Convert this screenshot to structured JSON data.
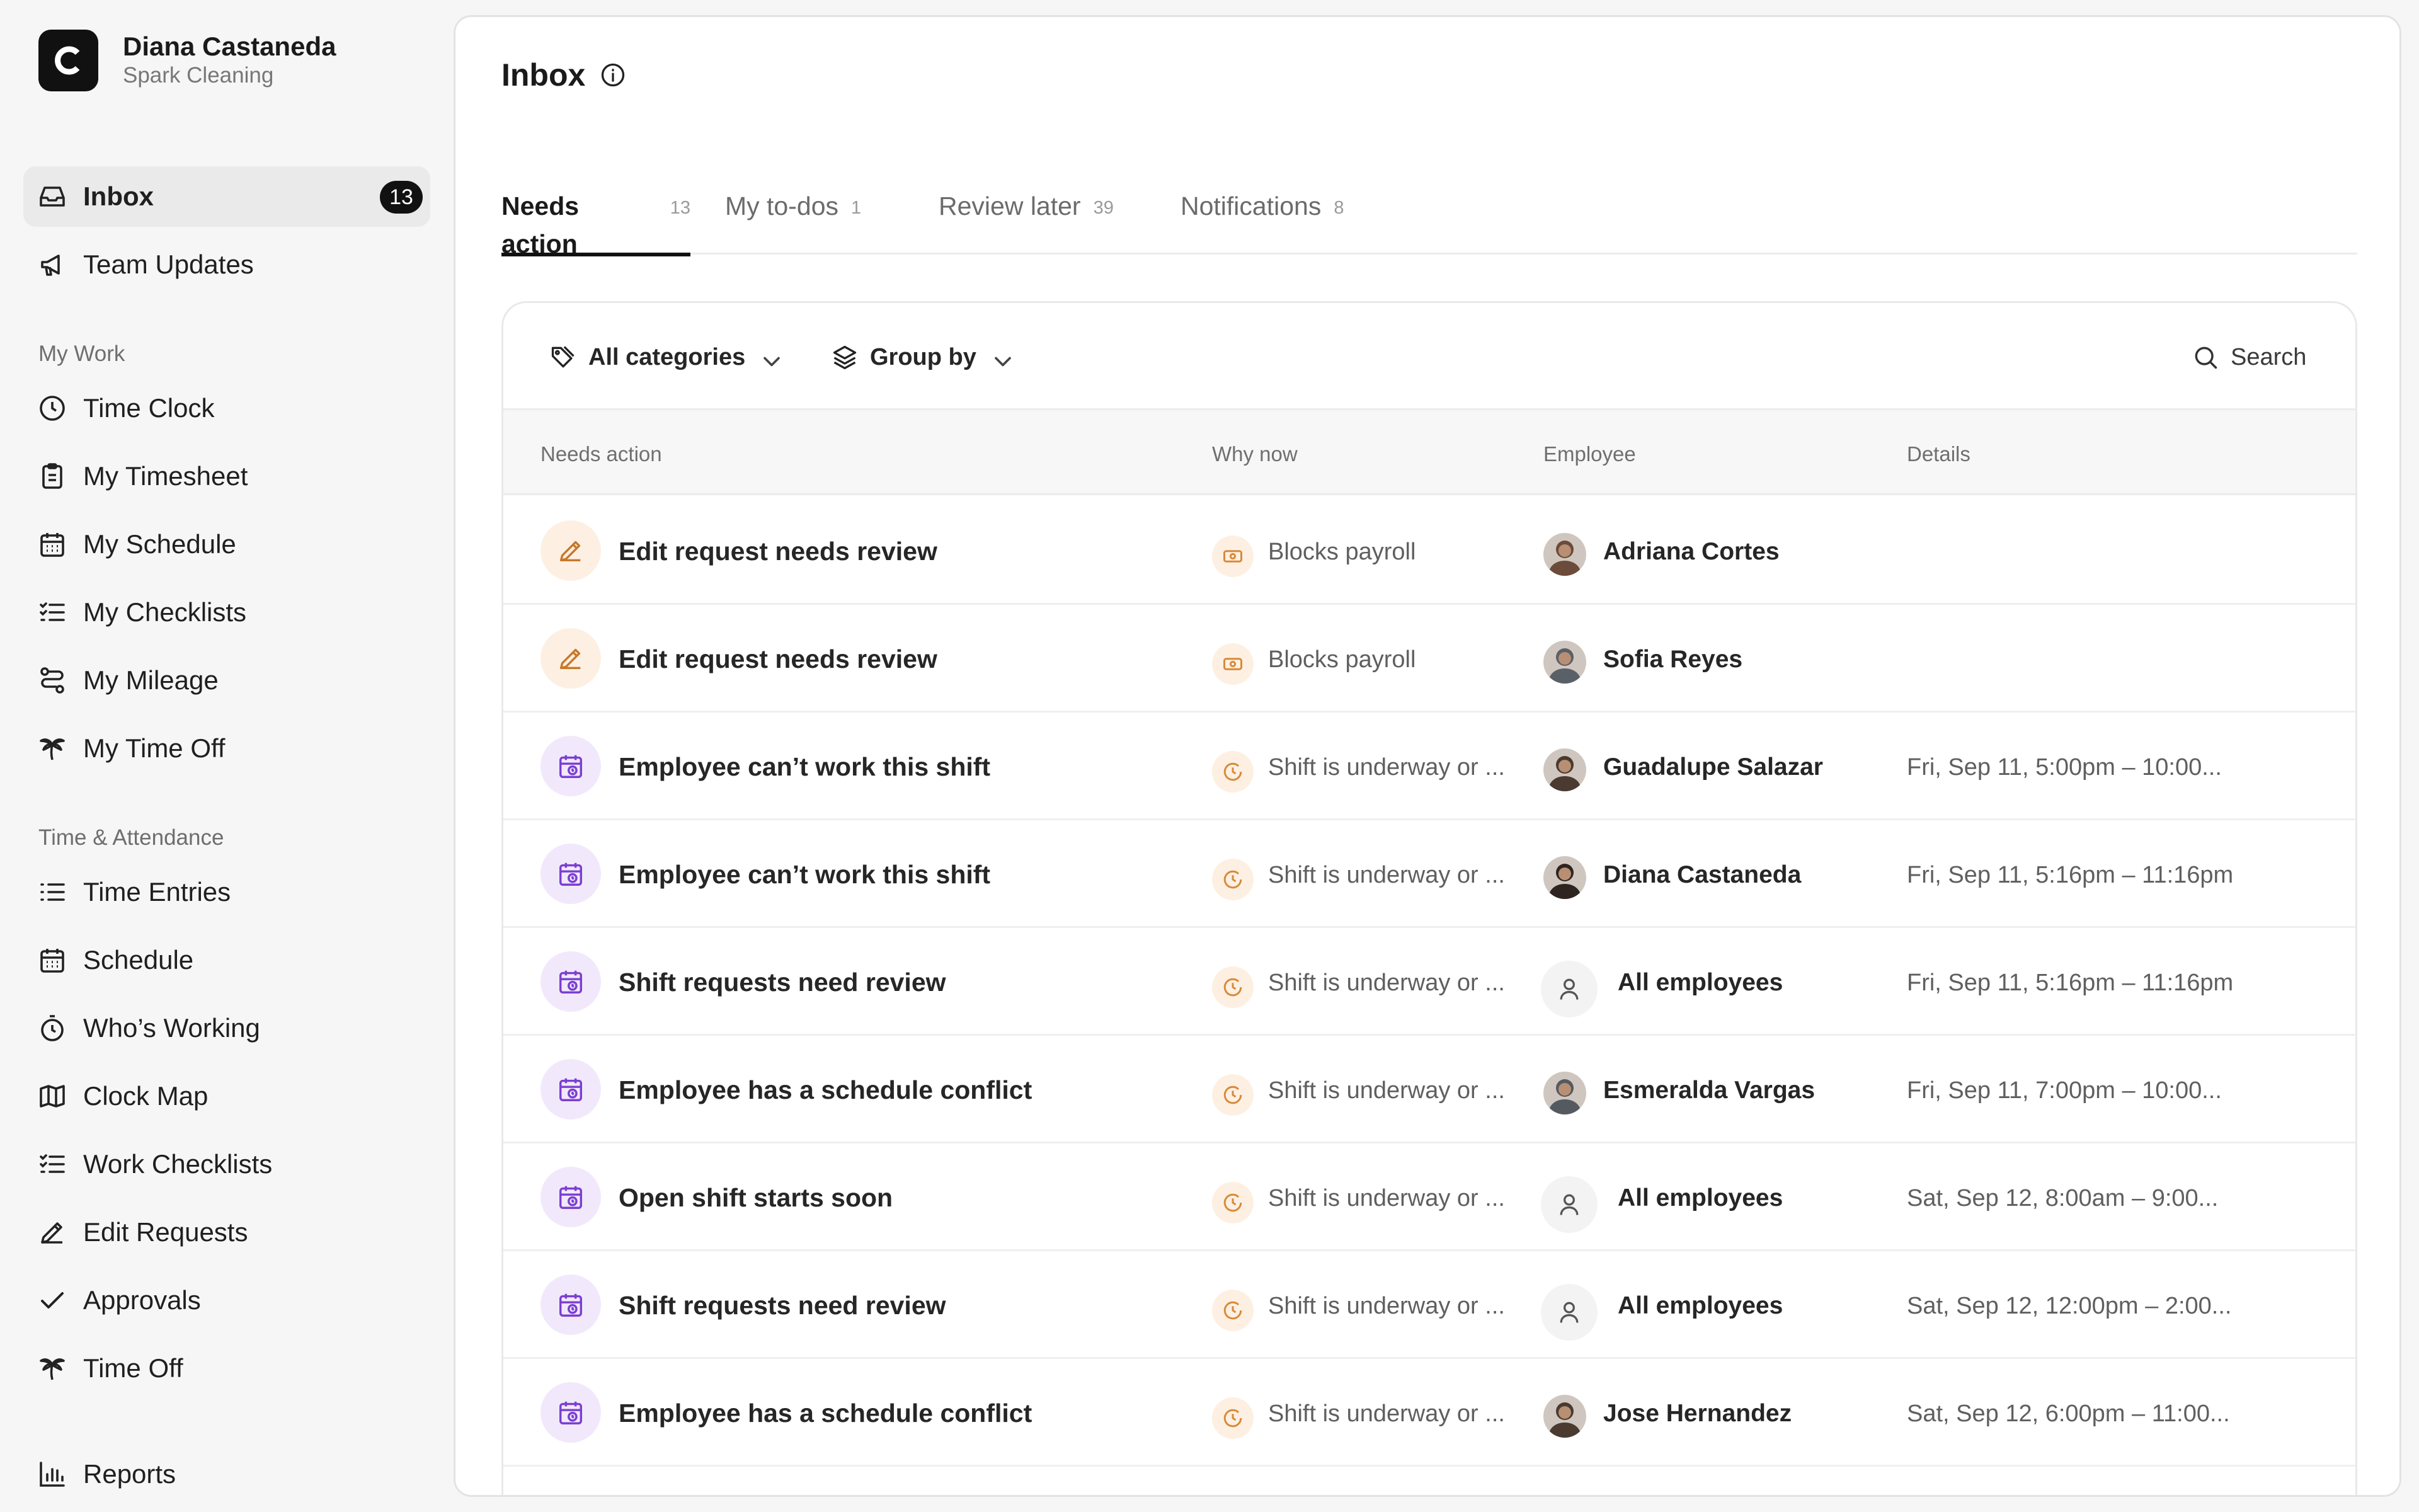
{
  "user": {
    "name": "Diana Castaneda",
    "company": "Spark Cleaning"
  },
  "sidebar": {
    "top_items": [
      {
        "label": "Inbox",
        "badge": "13"
      },
      {
        "label": "Team Updates"
      }
    ],
    "sections": [
      {
        "label": "My Work",
        "items": [
          {
            "label": "Time Clock"
          },
          {
            "label": "My Timesheet"
          },
          {
            "label": "My Schedule"
          },
          {
            "label": "My Checklists"
          },
          {
            "label": "My Mileage"
          },
          {
            "label": "My Time Off"
          }
        ]
      },
      {
        "label": "Time & Attendance",
        "items": [
          {
            "label": "Time Entries"
          },
          {
            "label": "Schedule"
          },
          {
            "label": "Who’s Working"
          },
          {
            "label": "Clock Map"
          },
          {
            "label": "Work Checklists"
          },
          {
            "label": "Edit Requests"
          },
          {
            "label": "Approvals"
          },
          {
            "label": "Time Off"
          }
        ]
      }
    ],
    "bottom_items": [
      {
        "label": "Reports"
      }
    ]
  },
  "page": {
    "title": "Inbox"
  },
  "tabs": [
    {
      "label": "Needs action",
      "count": "13",
      "active": true
    },
    {
      "label": "My to-dos",
      "count": "1"
    },
    {
      "label": "Review later",
      "count": "39"
    },
    {
      "label": "Notifications",
      "count": "8"
    }
  ],
  "toolbar": {
    "categories_label": "All categories",
    "group_by_label": "Group by",
    "search_label": "Search"
  },
  "table": {
    "headers": {
      "action": "Needs action",
      "why": "Why now",
      "employee": "Employee",
      "details": "Details"
    },
    "rows": [
      {
        "action": "Edit request needs review",
        "action_icon": "pencil-icon",
        "why": "Blocks payroll",
        "why_icon": "money-icon",
        "employee": "Adriana Cortes",
        "details": ""
      },
      {
        "action": "Edit request needs review",
        "action_icon": "pencil-icon",
        "why": "Blocks payroll",
        "why_icon": "money-icon",
        "employee": "Sofia Reyes",
        "details": ""
      },
      {
        "action": "Employee can’t work this shift",
        "action_icon": "calendar-clock-icon",
        "why": "Shift is underway or ...",
        "why_icon": "clock-icon",
        "employee": "Guadalupe Salazar",
        "details": "Fri, Sep 11, 5:00pm – 10:00..."
      },
      {
        "action": "Employee can’t work this shift",
        "action_icon": "calendar-clock-icon",
        "why": "Shift is underway or ...",
        "why_icon": "clock-icon",
        "employee": "Diana Castaneda",
        "details": "Fri, Sep 11, 5:16pm – 11:16pm"
      },
      {
        "action": "Shift requests need review",
        "action_icon": "calendar-clock-icon",
        "why": "Shift is underway or ...",
        "why_icon": "clock-icon",
        "employee": "All employees",
        "details": "Fri, Sep 11, 5:16pm – 11:16pm"
      },
      {
        "action": "Employee has a schedule conflict",
        "action_icon": "calendar-clock-icon",
        "why": "Shift is underway or ...",
        "why_icon": "clock-icon",
        "employee": "Esmeralda Vargas",
        "details": "Fri, Sep 11, 7:00pm – 10:00..."
      },
      {
        "action": "Open shift starts soon",
        "action_icon": "calendar-clock-icon",
        "why": "Shift is underway or ...",
        "why_icon": "clock-icon",
        "employee": "All employees",
        "details": "Sat, Sep 12, 8:00am – 9:00..."
      },
      {
        "action": "Shift requests need review",
        "action_icon": "calendar-clock-icon",
        "why": "Shift is underway or ...",
        "why_icon": "clock-icon",
        "employee": "All employees",
        "details": "Sat, Sep 12, 12:00pm – 2:00..."
      },
      {
        "action": "Employee has a schedule conflict",
        "action_icon": "calendar-clock-icon",
        "why": "Shift is underway or ...",
        "why_icon": "clock-icon",
        "employee": "Jose Hernandez",
        "details": "Sat, Sep 12, 6:00pm – 11:00..."
      }
    ]
  },
  "colors": {
    "accent": "#111111",
    "edit_icon": "#c8782a",
    "calendar_icon": "#7b3fd1",
    "why_icon": "#d98a3a"
  }
}
